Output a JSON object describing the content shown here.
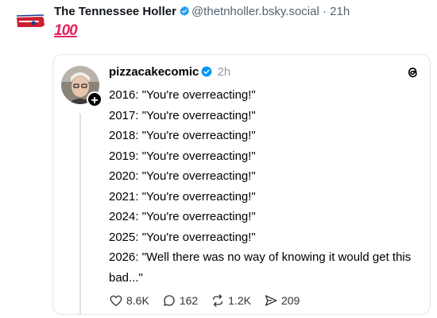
{
  "outer_post": {
    "author_name": "The Tennessee Holler",
    "handle": "@thetnholler.bsky.social",
    "separator": "·",
    "time": "21h",
    "body_emoji": "100"
  },
  "quoted_post": {
    "author": "pizzacakecomic",
    "time": "2h",
    "lines": [
      "2016: \"You're overreacting!\"",
      "2017: \"You're overreacting!\"",
      "2018: \"You're overreacting!\"",
      "2019: \"You're overreacting!\"",
      "2020: \"You're overreacting!\"",
      "2021: \"You're overreacting!\"",
      "2024: \"You're overreacting!\"",
      "2025: \"You're overreacting!\"",
      "2026: \"Well there was no way of knowing it would get this bad...\""
    ],
    "stats": {
      "likes": "8.6K",
      "replies": "162",
      "reposts": "1.2K",
      "shares": "209"
    }
  },
  "colors": {
    "verified_blue": "#1d9bf0",
    "threads_verified_blue": "#0095f6",
    "emoji_red": "#e0245e"
  }
}
